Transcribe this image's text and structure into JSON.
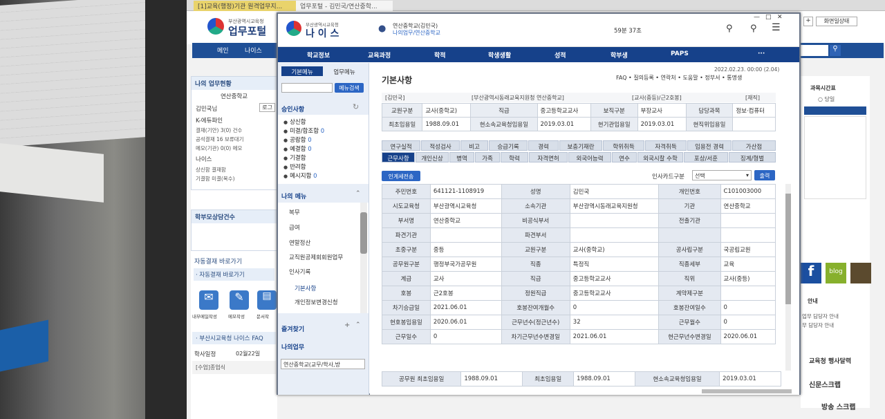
{
  "browser_tabs": [
    "[1]교육(행정)기관 원격업무지...",
    "업무포털 - 김민국/연산중학..."
  ],
  "bg": {
    "portal_logo_small": "부산광역시교육청",
    "portal_logo": "업무포털",
    "nav": [
      "메인",
      "나이스"
    ],
    "top_right": [
      "+",
      "화면일상태"
    ],
    "my_status": "나의 업무현황",
    "school": "연산중학교",
    "user": "김민국님",
    "login_btn": "로그",
    "k_edufine": "K-에듀파인",
    "k_rows": [
      "결재(기안) 3(0) 건수",
      "공석결재 16 보류대기",
      "메모(기관) 0(0) 메모"
    ],
    "neis": "나이스",
    "neis_rows": [
      "상신함 결재함",
      "기결함 미결(복수)"
    ],
    "school_status": "학부모상담건수",
    "shortcut": "자동결재 바로가기",
    "shortcut2": "· 자동결재 바로가기",
    "bottom_icons": [
      "내부메일작성",
      "메모작성",
      "문서작"
    ],
    "faq": "· 부산시교육청 나이스 FAQ",
    "calendar": "학사일정",
    "cal_date": "02월22일",
    "cal_item": "[수업]종업식",
    "right_title": "과목시간표",
    "right_radio": "당일",
    "right_notice": "안내",
    "right_notice_rows": [
      "업무 담당자 안내",
      "무 담당자 안내"
    ],
    "event": "교육청 행사달력",
    "news": "신문스크랩",
    "broadcast": "방송 스크랩",
    "blog": "blog"
  },
  "win": {
    "logo_small": "부산광역시교육청",
    "logo": "나 이 스",
    "user_line1": "연산중학교(김민국)",
    "user_line2": "나의업무/연산중학교",
    "timer": "59분 37초",
    "menu": [
      "학교정보",
      "교육과정",
      "학적",
      "학생생활",
      "성적",
      "학부생",
      "PAPS",
      "···"
    ],
    "left": {
      "tab1": "기본메뉴",
      "tab2": "업무메뉴",
      "search_btn": "메뉴검색",
      "approval": "승인사항",
      "approval_items": [
        {
          "label": "상신함",
          "count": ""
        },
        {
          "label": "미결/합조함",
          "count": "0"
        },
        {
          "label": "공람함",
          "count": "0"
        },
        {
          "label": "예결함",
          "count": "0"
        },
        {
          "label": "기결함",
          "count": ""
        },
        {
          "label": "반려함",
          "count": ""
        },
        {
          "label": "메시지함",
          "count": "0"
        }
      ],
      "my_menu": "나의 메뉴",
      "my_items": [
        "복무",
        "급여",
        "연말정산",
        "교직원공제회회원업무",
        "인사기록",
        "기본사항",
        "개인정보변경신청"
      ],
      "favorites": "즐겨찾기",
      "my_work": "나의업무",
      "select": "연산중학교(교무/학사,방"
    },
    "main": {
      "title": "기본사항",
      "datetime": "2022.02.23. 00:00 (2.04)",
      "links": [
        "FAQ",
        "질의등록",
        "연락처",
        "도움말",
        "정부서",
        "통명생"
      ],
      "info_header": {
        "name": "[김민국]",
        "org": "[부산광역시동래교육지원청 연산중학교]",
        "rank": "[교사(중등)/근2호봉]",
        "status": "[재직]"
      },
      "info_rows": [
        [
          "교원구분",
          "교사(중학교)",
          "직급",
          "중고등학교교사",
          "보직구분",
          "부장교사",
          "담당과목",
          "정보·컴퓨터"
        ],
        [
          "최초임용일",
          "1988.09.01",
          "현소속교육청임용일",
          "2019.03.01",
          "현기관임용일",
          "2019.03.01",
          "현직위임용일",
          ""
        ]
      ],
      "tabs_row1": [
        "연구실적",
        "적성검사",
        "비고",
        "승급기록",
        "경력",
        "보충기재란",
        "학위취득",
        "자격취득",
        "임용전 경력",
        "가산점"
      ],
      "tabs_row2": [
        "근무사항",
        "개인신상",
        "병역",
        "가족",
        "학력",
        "자격면허",
        "외국어능력",
        "연수",
        "외국시찰 수학",
        "포상/서훈",
        "징계/형벌"
      ],
      "personal_btn": "인계세전송",
      "card_label": "인사카드구분",
      "card_select": "선택",
      "print_btn": "출력",
      "grid": [
        [
          "주민번호",
          "641121-1108919",
          "성명",
          "김민국",
          "개인번호",
          "C101003000"
        ],
        [
          "시도교육청",
          "부산광역시교육청",
          "소속기관",
          "부산광역시동래교육지원청",
          "기관",
          "연산중학교"
        ],
        [
          "부서명",
          "연산중학교",
          "비공식부서",
          "",
          "전출기관",
          ""
        ],
        [
          "파견기관",
          "",
          "파견부서",
          "",
          "",
          ""
        ],
        [
          "초중구분",
          "중등",
          "교원구분",
          "교사(중학교)",
          "공사립구분",
          "국공립교원"
        ],
        [
          "공무원구분",
          "행정부국가공무원",
          "직종",
          "특정직",
          "직종세부",
          "교육"
        ],
        [
          "계급",
          "교사",
          "직급",
          "중고등학교교사",
          "직위",
          "교사(중등)"
        ],
        [
          "호봉",
          "근2호봉",
          "정원직급",
          "중고등학교교사",
          "계약제구분",
          ""
        ],
        [
          "차기승급일",
          "2021.06.01",
          "호봉잔여개월수",
          "0",
          "호봉잔여일수",
          "0"
        ],
        [
          "현호봉임용일",
          "2020.06.01",
          "근무년수(정근년수)",
          "32",
          "근무월수",
          "0"
        ],
        [
          "근무일수",
          "0",
          "차기근무년수변경일",
          "2021.06.01",
          "현근무년수변경일",
          "2020.06.01"
        ]
      ],
      "bottom": [
        "공무원 최초임용일",
        "1988.09.01",
        "최초임용일",
        "1988.09.01",
        "현소속교육청임용일",
        "2019.03.01"
      ]
    }
  }
}
